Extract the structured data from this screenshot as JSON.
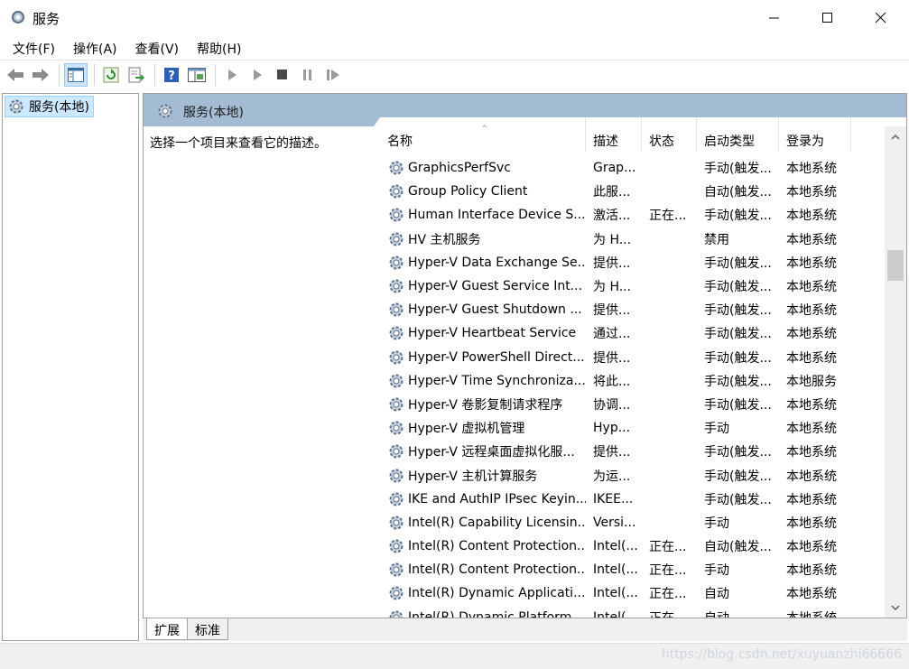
{
  "window": {
    "title": "服务"
  },
  "menu": [
    "文件(F)",
    "操作(A)",
    "查看(V)",
    "帮助(H)"
  ],
  "toolbar": {
    "buttons": [
      "back-icon",
      "forward-icon",
      "show-tree-icon",
      "refresh-icon",
      "export-icon",
      "help-icon",
      "properties-icon",
      "start-icon",
      "start-alt-icon",
      "stop-icon",
      "pause-icon",
      "restart-icon"
    ]
  },
  "tree": {
    "item": "服务(本地)"
  },
  "pane": {
    "header": "服务(本地)",
    "description": "选择一个项目来查看它的描述。"
  },
  "list": {
    "columns": [
      "名称",
      "描述",
      "状态",
      "启动类型",
      "登录为"
    ],
    "rows": [
      [
        "GraphicsPerfSvc",
        "Grap...",
        "",
        "手动(触发...",
        "本地系统"
      ],
      [
        "Group Policy Client",
        "此服...",
        "",
        "自动(触发...",
        "本地系统"
      ],
      [
        "Human Interface Device S...",
        "激活...",
        "正在...",
        "手动(触发...",
        "本地系统"
      ],
      [
        "HV 主机服务",
        "为 H...",
        "",
        "禁用",
        "本地系统"
      ],
      [
        "Hyper-V Data Exchange Se...",
        "提供...",
        "",
        "手动(触发...",
        "本地系统"
      ],
      [
        "Hyper-V Guest Service Int...",
        "为 H...",
        "",
        "手动(触发...",
        "本地系统"
      ],
      [
        "Hyper-V Guest Shutdown ...",
        "提供...",
        "",
        "手动(触发...",
        "本地系统"
      ],
      [
        "Hyper-V Heartbeat Service",
        "通过...",
        "",
        "手动(触发...",
        "本地系统"
      ],
      [
        "Hyper-V PowerShell Direct...",
        "提供...",
        "",
        "手动(触发...",
        "本地系统"
      ],
      [
        "Hyper-V Time Synchroniza...",
        "将此...",
        "",
        "手动(触发...",
        "本地服务"
      ],
      [
        "Hyper-V 卷影复制请求程序",
        "协调...",
        "",
        "手动(触发...",
        "本地系统"
      ],
      [
        "Hyper-V 虚拟机管理",
        "Hyp...",
        "",
        "手动",
        "本地系统"
      ],
      [
        "Hyper-V 远程桌面虚拟化服...",
        "提供...",
        "",
        "手动(触发...",
        "本地系统"
      ],
      [
        "Hyper-V 主机计算服务",
        "为运...",
        "",
        "手动(触发...",
        "本地系统"
      ],
      [
        "IKE and AuthIP IPsec Keyin...",
        "IKEE...",
        "",
        "手动(触发...",
        "本地系统"
      ],
      [
        "Intel(R) Capability Licensin...",
        "Versi...",
        "",
        "手动",
        "本地系统"
      ],
      [
        "Intel(R) Content Protection...",
        "Intel(...",
        "正在...",
        "自动(触发...",
        "本地系统"
      ],
      [
        "Intel(R) Content Protection...",
        "Intel(...",
        "正在...",
        "手动",
        "本地系统"
      ],
      [
        "Intel(R) Dynamic Applicati...",
        "Intel(...",
        "正在...",
        "自动",
        "本地系统"
      ],
      [
        "Intel(R) Dynamic Platform...",
        "Intel(...",
        "正在...",
        "自动",
        "本地系统"
      ]
    ]
  },
  "tabs": [
    "扩展",
    "标准"
  ],
  "watermark": "https://blog.csdn.net/xuyuanzhi66666",
  "colors": {
    "header_bg": "#a4bcd3",
    "selected_bg": "#cce8ff"
  }
}
